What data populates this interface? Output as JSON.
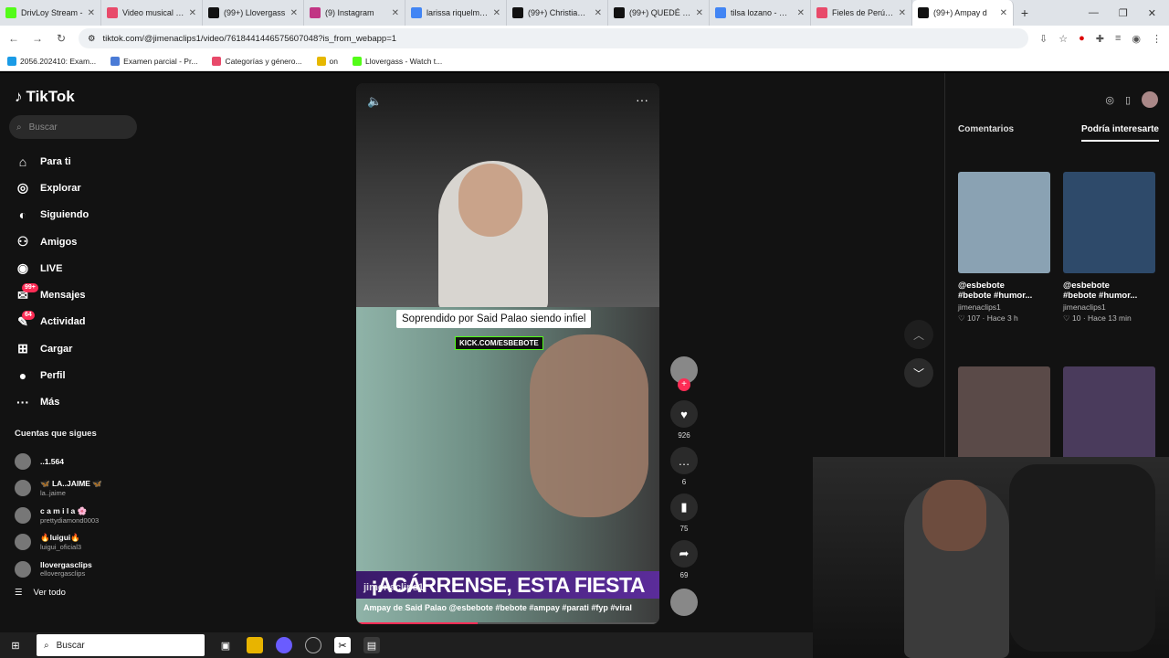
{
  "browser": {
    "tabs": [
      {
        "title": "DrivLoy Stream -",
        "color": "#53fc18"
      },
      {
        "title": "Video musical de",
        "color": "#e84a6a"
      },
      {
        "title": "(99+) Llovergass",
        "color": "#111111"
      },
      {
        "title": "(9) Instagram",
        "color": "#c13584"
      },
      {
        "title": "larissa riquelme -",
        "color": "#4285f4"
      },
      {
        "title": "(99+) Christian Do",
        "color": "#111111"
      },
      {
        "title": "(99+) QUEDÉ FRIC",
        "color": "#111111"
      },
      {
        "title": "tilsa lozano - Busc",
        "color": "#4285f4"
      },
      {
        "title": "Fieles de Perú: Cr",
        "color": "#e84a6a"
      },
      {
        "title": "(99+) Ampay d",
        "color": "#111111",
        "active": true
      }
    ],
    "url": "tiktok.com/@jimenaclips1/video/7618441446575607048?is_from_webapp=1",
    "bookmarks": [
      {
        "label": "2056.202410: Exam...",
        "color": "#1a9be6"
      },
      {
        "label": "Examen parcial - Pr...",
        "color": "#4a7bd6"
      },
      {
        "label": "Categorías y género...",
        "color": "#e84a6a"
      },
      {
        "label": "on",
        "color": "#e6b800"
      },
      {
        "label": "Llovergass - Watch t...",
        "color": "#53fc18"
      }
    ]
  },
  "sidebar": {
    "logo": "TikTok",
    "search_placeholder": "Buscar",
    "nav": [
      {
        "label": "Para ti",
        "icon": "home-icon"
      },
      {
        "label": "Explorar",
        "icon": "compass-icon"
      },
      {
        "label": "Siguiendo",
        "icon": "following-icon"
      },
      {
        "label": "Amigos",
        "icon": "friends-icon"
      },
      {
        "label": "LIVE",
        "icon": "live-icon"
      },
      {
        "label": "Mensajes",
        "icon": "messages-icon",
        "badge": "99+"
      },
      {
        "label": "Actividad",
        "icon": "activity-icon",
        "badge": "64"
      },
      {
        "label": "Cargar",
        "icon": "upload-icon"
      },
      {
        "label": "Perfil",
        "icon": "profile-icon"
      },
      {
        "label": "Más",
        "icon": "more-icon"
      }
    ],
    "following_title": "Cuentas que sigues",
    "following": [
      {
        "name": "..1.564",
        "handle": ""
      },
      {
        "name": "🦋 LA..JAIME 🦋",
        "handle": "la..jaime"
      },
      {
        "name": "c a m i l a 🌸",
        "handle": "prettydiamond0003"
      },
      {
        "name": "🔥luigui🔥",
        "handle": "luigui_oficial3"
      },
      {
        "name": "llovergasclips",
        "handle": "ellovergasclips"
      }
    ],
    "see_all": "Ver todo"
  },
  "video": {
    "overlay_title": "Soprendido por Said Palao siendo infiel",
    "kick_label": "KICK.COM/ESBEBOTE",
    "banner": "¡ACÁRRENSE, ESTA FIESTA",
    "author": "jimenaclips1",
    "description": "Ampay de Said Palao @esbebote #bebote #ampay #parati #fyp #viral",
    "progress": 0.4
  },
  "actions": {
    "likes": "926",
    "comments": "6",
    "saves": "75",
    "shares": "69"
  },
  "right_panel": {
    "tabs": [
      "Comentarios",
      "Podría interesarte"
    ],
    "active_tab": 1,
    "cards": [
      {
        "handle": "@esbebote",
        "tags": "#bebote #humor...",
        "user": "jimenaclips1",
        "likes": "107",
        "time": "Hace 3 h",
        "color": "#8aa2b3"
      },
      {
        "handle": "@esbebote",
        "tags": "#bebote #humor...",
        "user": "jimenaclips1",
        "likes": "10",
        "time": "Hace 13 min",
        "color": "#2e4a6a"
      },
      {
        "handle": "",
        "tags": "",
        "user": "",
        "likes": "",
        "time": "",
        "color": "#5a4a48"
      },
      {
        "handle": "",
        "tags": "",
        "user": "",
        "likes": "",
        "time": "",
        "color": "#4a3b5c"
      }
    ]
  },
  "taskbar": {
    "search_placeholder": "Buscar"
  }
}
